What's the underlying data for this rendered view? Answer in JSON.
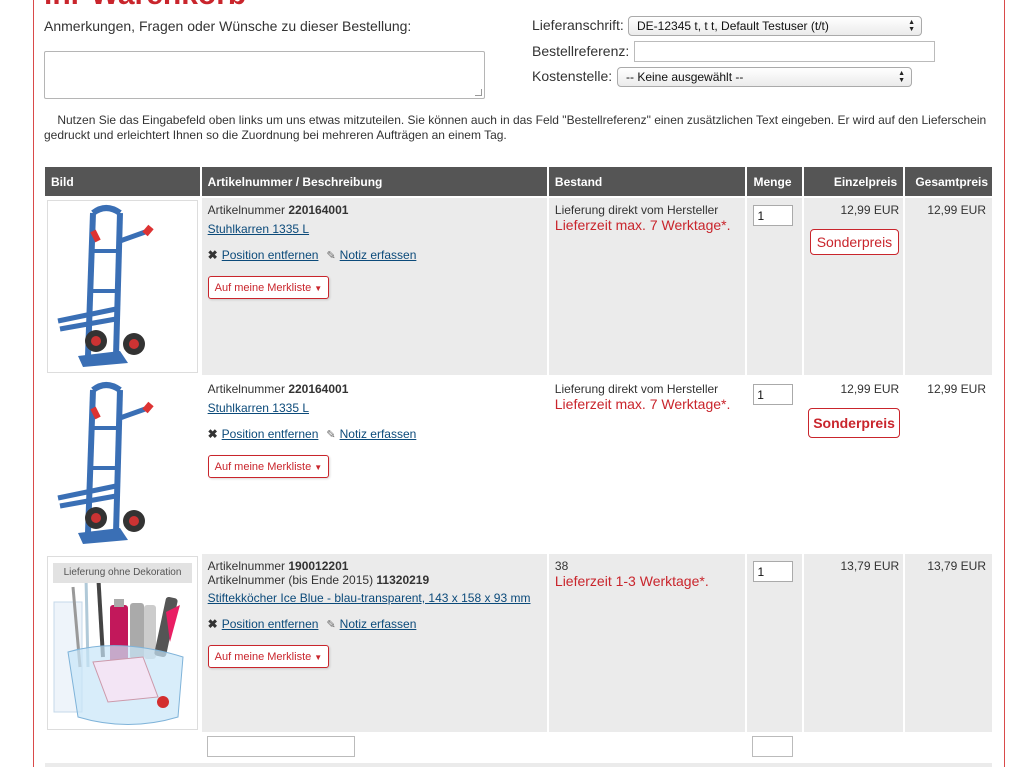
{
  "page": {
    "heading_partial": "ihr Warenkorb"
  },
  "notes": {
    "label": "Anmerkungen, Fragen oder Wünsche zu dieser Bestellung:",
    "value": ""
  },
  "order_form": {
    "address_label": "Lieferanschrift:",
    "address_value": "DE-12345 t, t t, Default Testuser (t/t)",
    "reference_label": "Bestellreferenz:",
    "reference_value": "",
    "cost_center_label": "Kostenstelle:",
    "cost_center_value": "-- Keine ausgewählt --"
  },
  "info_text": "Nutzen Sie das Eingabefeld oben links um uns etwas mitzuteilen. Sie können auch in das Feld \"Bestellreferenz\" einen zusätzlichen Text eingeben. Er wird auf den Lieferschein gedruckt und erleichtert Ihnen so die Zuordnung bei mehreren Aufträgen an einem Tag.",
  "table": {
    "headers": {
      "image": "Bild",
      "article": "Artikelnummer / Beschreibung",
      "stock": "Bestand",
      "qty": "Menge",
      "unit_price": "Einzelpreis",
      "total": "Gesamtpreis"
    },
    "rows": [
      {
        "article_label": "Artikelnummer",
        "article_number": "220164001",
        "name": "Stuhlkarren 1335 L",
        "remove": "Position entfernen",
        "note": "Notiz erfassen",
        "wishlist": "Auf meine Merkliste",
        "stock_text": "Lieferung direkt vom Hersteller",
        "lead_time": "Lieferzeit max. 7 Werktage*.",
        "qty": "1",
        "unit_price": "12,99 EUR",
        "special": "Sonderpreis",
        "total": "12,99 EUR"
      },
      {
        "article_label": "Artikelnummer",
        "article_number": "220164001",
        "name": "Stuhlkarren 1335 L",
        "remove": "Position entfernen",
        "note": "Notiz erfassen",
        "wishlist": "Auf meine Merkliste",
        "stock_text": "Lieferung direkt vom Hersteller",
        "lead_time": "Lieferzeit max. 7 Werktage*.",
        "qty": "1",
        "unit_price": "12,99 EUR",
        "special": "Sonderpreis",
        "total": "12,99 EUR"
      },
      {
        "image_caption": "Lieferung ohne Dekoration",
        "article_label": "Artikelnummer",
        "article_number": "190012201",
        "article_label_old": "Artikelnummer (bis Ende 2015)",
        "article_number_old": "11320219",
        "name": "Stiftekköcher Ice Blue - blau-transparent, 143 x 158 x 93 mm",
        "remove": "Position entfernen",
        "note": "Notiz erfassen",
        "wishlist": "Auf meine Merkliste",
        "stock_text": "38",
        "lead_time": "Lieferzeit 1-3 Werktage*.",
        "qty": "1",
        "unit_price": "13,79 EUR",
        "total": "13,79 EUR"
      }
    ]
  },
  "colors": {
    "accent_red": "#c9252c",
    "header_bg": "#555555",
    "row_bg": "#ebebeb",
    "link_blue": "#0b4a7a"
  }
}
